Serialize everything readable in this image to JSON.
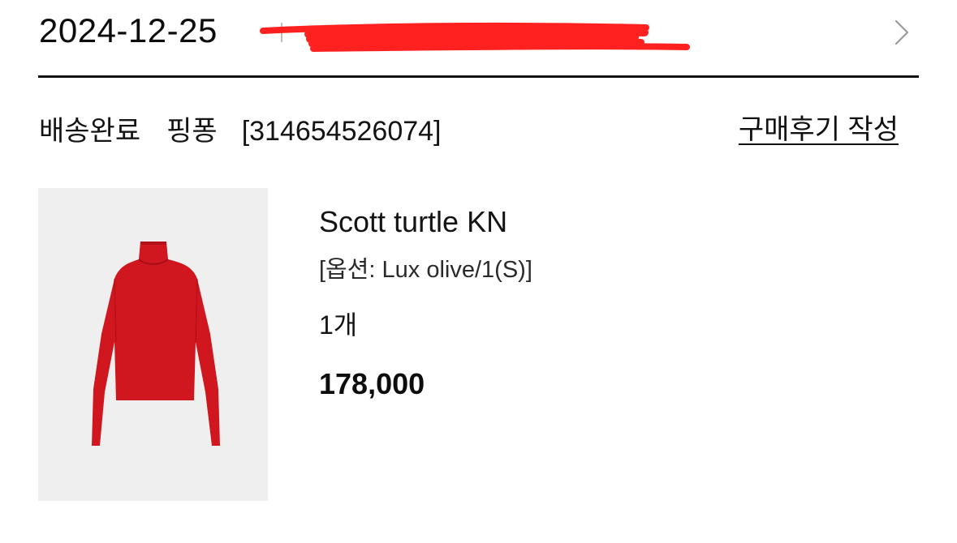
{
  "order": {
    "date": "2024-12-25",
    "status": "배송완료",
    "seller": "핑퐁",
    "order_number": "[314654526074]",
    "review_link": "구매후기 작성"
  },
  "product": {
    "name": "Scott turtle KN",
    "option": "[옵션: Lux olive/1(S)]",
    "quantity": "1개",
    "price": "178,000",
    "image_icon": "red-turtleneck-sweater"
  },
  "colors": {
    "redaction": "#ff2020",
    "sweater": "#d0161e",
    "thumbnail_bg": "#efefef"
  }
}
